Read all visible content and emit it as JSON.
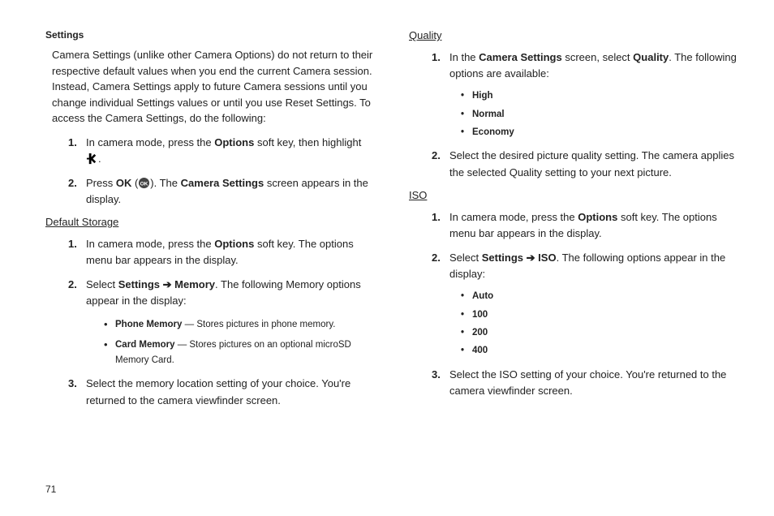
{
  "left": {
    "heading": "Settings",
    "intro": "Camera Settings (unlike other Camera Options) do not return to their respective default values when you end the current Camera session. Instead, Camera Settings apply to future Camera sessions until you change individual Settings values or until you use Reset Settings. To access the Camera Settings, do the following:",
    "step1_a": "In camera mode, press the ",
    "step1_b": "Options",
    "step1_c": " soft key, then highlight ",
    "step1_d": ".",
    "step2_a": "Press ",
    "step2_b": "OK",
    "step2_c": " (",
    "step2_d": "). The ",
    "step2_e": "Camera Settings",
    "step2_f": " screen appears in the display.",
    "defaultStorage": {
      "heading": "Default Storage",
      "s1_a": "In camera mode, press the ",
      "s1_b": "Options",
      "s1_c": " soft key. The options menu bar appears in the display.",
      "s2_a": "Select ",
      "s2_b": "Settings",
      "s2_arrow": " ➔ ",
      "s2_c": "Memory",
      "s2_d": ". The following Memory options appear in the display:",
      "b1_label": "Phone Memory",
      "b1_desc": " — Stores pictures in phone memory.",
      "b2_label": "Card Memory",
      "b2_desc": " — Stores pictures on an optional microSD Memory Card.",
      "s3": "Select the memory location setting of your choice. You're returned to the camera viewfinder screen."
    }
  },
  "right": {
    "quality": {
      "heading": "Quality",
      "s1_a": "In the ",
      "s1_b": "Camera Settings",
      "s1_c": " screen, select ",
      "s1_d": "Quality",
      "s1_e": ". The following options are available:",
      "opts": [
        "High",
        "Normal",
        "Economy"
      ],
      "s2": "Select the desired picture quality setting. The camera applies the selected Quality setting to your next picture."
    },
    "iso": {
      "heading": "ISO",
      "s1_a": "In camera mode, press the ",
      "s1_b": "Options",
      "s1_c": " soft key. The options menu bar appears in the display.",
      "s2_a": "Select ",
      "s2_b": "Settings",
      "s2_arrow": " ➔ ",
      "s2_c": "ISO",
      "s2_d": ". The following options appear in the display:",
      "opts": [
        "Auto",
        "100",
        "200",
        "400"
      ],
      "s3": "Select the ISO setting of your choice. You're returned to the camera viewfinder screen."
    }
  },
  "pageNumber": "71"
}
